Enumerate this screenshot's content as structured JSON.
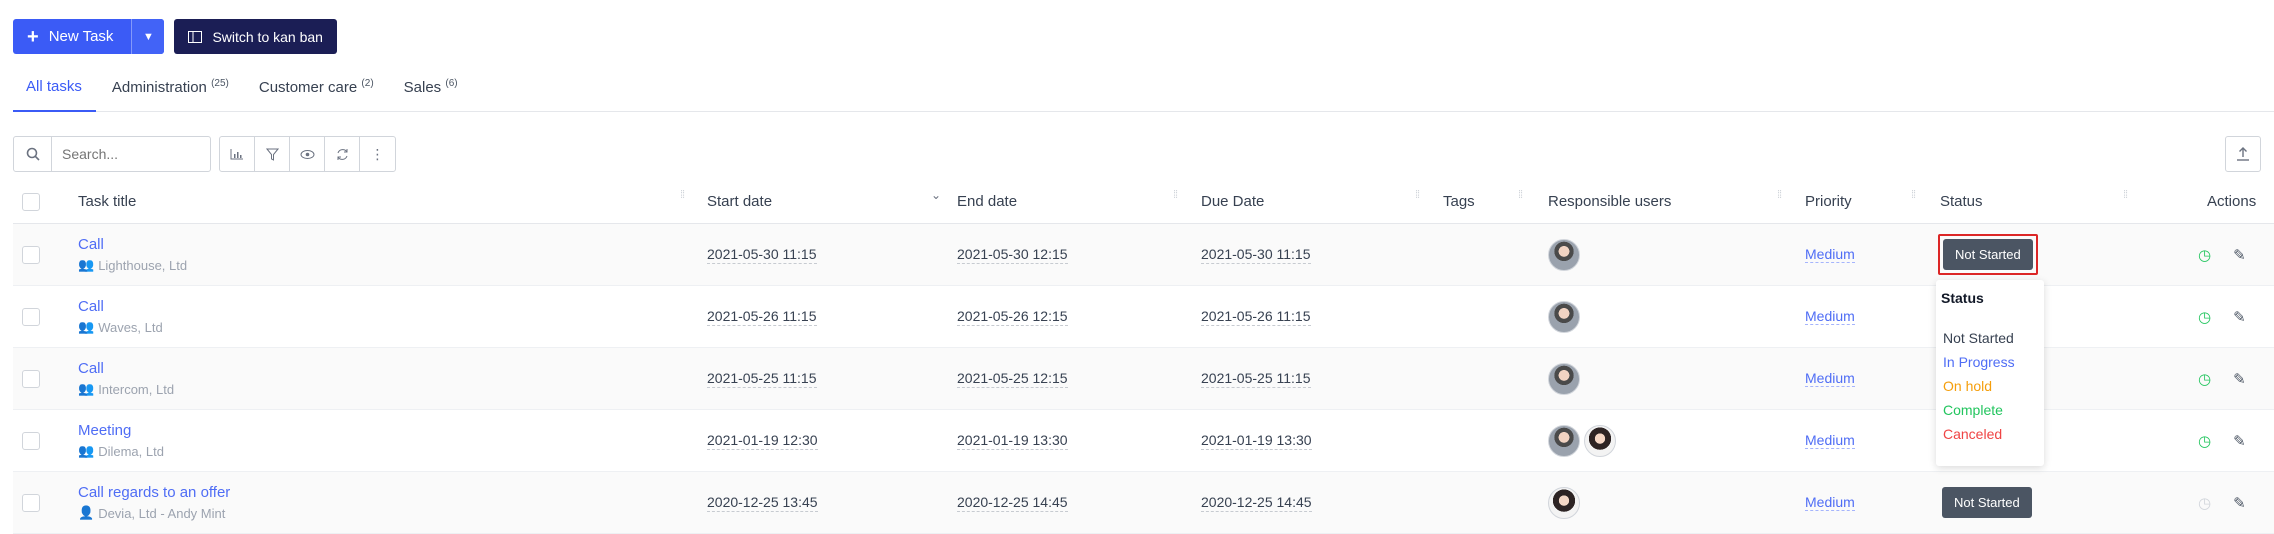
{
  "toolbar": {
    "new_task_label": "New Task",
    "kanban_label": "Switch to kan ban"
  },
  "tabs": [
    {
      "label": "All tasks",
      "count": ""
    },
    {
      "label": "Administration",
      "count": "(25)"
    },
    {
      "label": "Customer care",
      "count": "(2)"
    },
    {
      "label": "Sales",
      "count": "(6)"
    }
  ],
  "search": {
    "placeholder": "Search..."
  },
  "columns": {
    "title": "Task title",
    "start": "Start date",
    "end": "End date",
    "due": "Due Date",
    "tags": "Tags",
    "users": "Responsible users",
    "priority": "Priority",
    "status": "Status",
    "actions": "Actions"
  },
  "rows": [
    {
      "title": "Call",
      "sub": "Lighthouse, Ltd",
      "start": "2021-05-30 11:15",
      "end": "2021-05-30 12:15",
      "due": "2021-05-30 11:15",
      "priority": "Medium",
      "status": "Not Started"
    },
    {
      "title": "Call",
      "sub": "Waves, Ltd",
      "start": "2021-05-26 11:15",
      "end": "2021-05-26 12:15",
      "due": "2021-05-26 11:15",
      "priority": "Medium",
      "status": ""
    },
    {
      "title": "Call",
      "sub": "Intercom, Ltd",
      "start": "2021-05-25 11:15",
      "end": "2021-05-25 12:15",
      "due": "2021-05-25 11:15",
      "priority": "Medium",
      "status": ""
    },
    {
      "title": "Meeting",
      "sub": "Dilema, Ltd",
      "start": "2021-01-19 12:30",
      "end": "2021-01-19 13:30",
      "due": "2021-01-19 13:30",
      "priority": "Medium",
      "status": ""
    },
    {
      "title": "Call regards to an offer",
      "sub": "Devia, Ltd - Andy Mint",
      "start": "2020-12-25 13:45",
      "end": "2020-12-25 14:45",
      "due": "2020-12-25 14:45",
      "priority": "Medium",
      "status": "Not Started"
    }
  ],
  "status_menu": {
    "heading": "Status",
    "options": [
      "Not Started",
      "In Progress",
      "On hold",
      "Complete",
      "Canceled"
    ],
    "colors": [
      "#374151",
      "#4f6df5",
      "#f59e0b",
      "#22c55e",
      "#ef4444"
    ]
  },
  "colors": {
    "primary": "#3b5bf6",
    "dark_button": "#1b1e55",
    "status_button": "#4b5563",
    "highlight": "#dc2626"
  }
}
